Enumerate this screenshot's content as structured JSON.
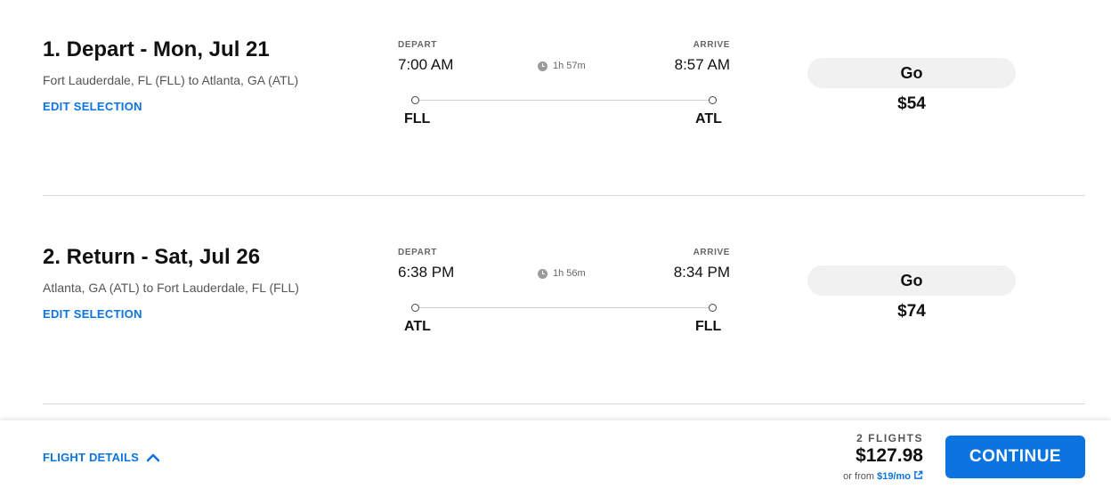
{
  "legs": [
    {
      "title": "1. Depart - Mon, Jul 21",
      "route": "Fort Lauderdale, FL (FLL) to Atlanta, GA (ATL)",
      "edit_label": "EDIT SELECTION",
      "depart_caption": "DEPART",
      "arrive_caption": "ARRIVE",
      "depart_time": "7:00 AM",
      "arrive_time": "8:57 AM",
      "duration": "1h 57m",
      "origin_code": "FLL",
      "dest_code": "ATL",
      "fare_label": "Go",
      "fare_price": "$54"
    },
    {
      "title": "2. Return - Sat, Jul 26",
      "route": "Atlanta, GA (ATL) to Fort Lauderdale, FL (FLL)",
      "edit_label": "EDIT SELECTION",
      "depart_caption": "DEPART",
      "arrive_caption": "ARRIVE",
      "depart_time": "6:38 PM",
      "arrive_time": "8:34 PM",
      "duration": "1h 56m",
      "origin_code": "ATL",
      "dest_code": "FLL",
      "fare_label": "Go",
      "fare_price": "$74"
    }
  ],
  "footer": {
    "details_label": "FLIGHT DETAILS",
    "flights_count": "2 FLIGHTS",
    "total_price": "$127.98",
    "monthly_prefix": "or from ",
    "monthly_amount": "$19/mo",
    "continue_label": "CONTINUE"
  },
  "colors": {
    "accent": "#0b74e0",
    "pill_bg": "#f1f1f1"
  },
  "icons": {
    "clock": "clock-icon",
    "chevron": "chevron-up-icon",
    "external": "external-link-icon"
  }
}
